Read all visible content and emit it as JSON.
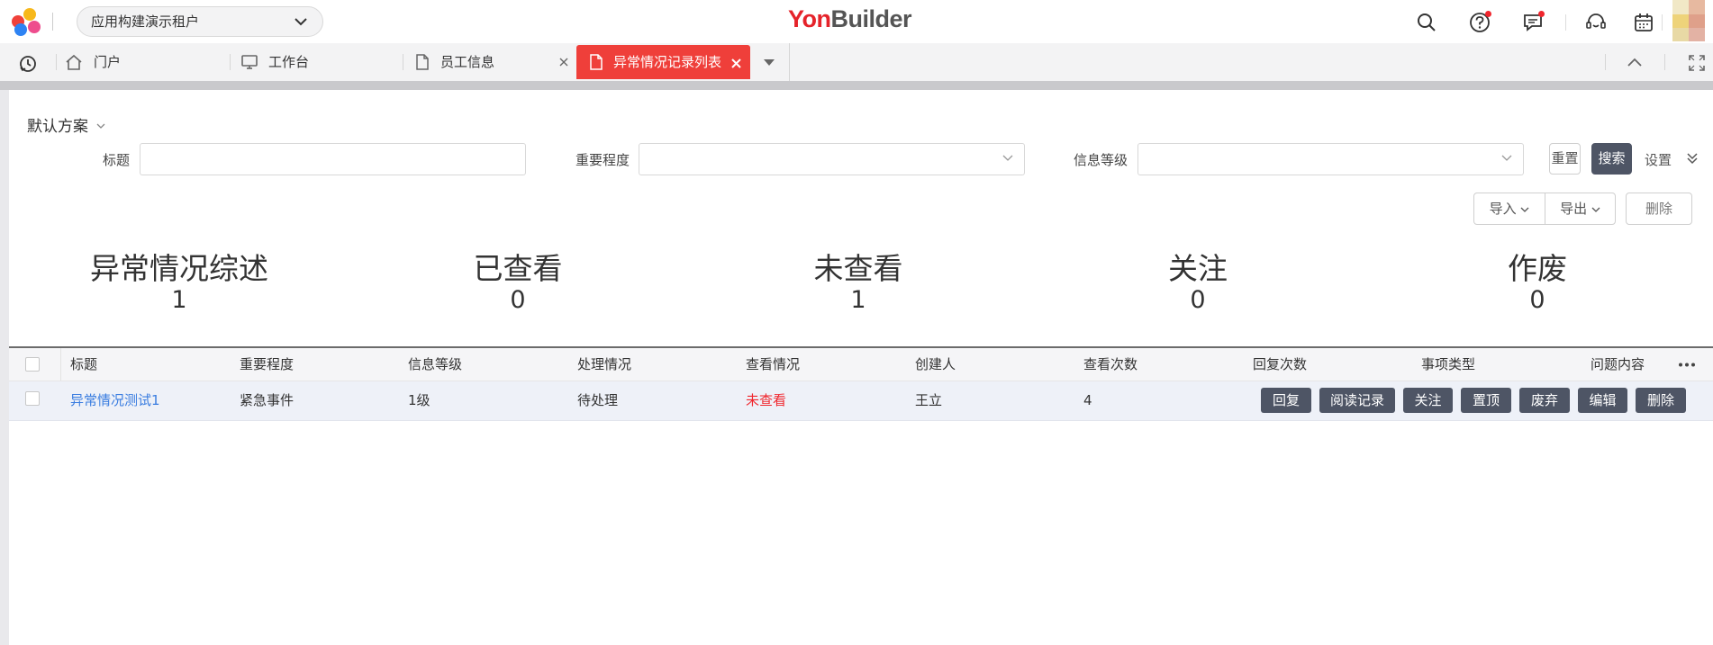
{
  "header": {
    "tenant": "应用构建演示租户",
    "brand_prefix": "Yon",
    "brand_suffix": "Builder"
  },
  "tabs": [
    {
      "label": "门户",
      "icon": "home-icon"
    },
    {
      "label": "工作台",
      "icon": "monitor-icon"
    },
    {
      "label": "员工信息",
      "icon": "document-icon"
    },
    {
      "label": "异常情况记录列表",
      "icon": "document-icon",
      "active": true
    }
  ],
  "filter": {
    "plan": "默认方案",
    "fields": [
      {
        "label": "标题",
        "type": "text",
        "value": ""
      },
      {
        "label": "重要程度",
        "type": "select",
        "value": ""
      },
      {
        "label": "信息等级",
        "type": "select",
        "value": ""
      }
    ],
    "reset": "重置",
    "search": "搜索",
    "settings": "设置"
  },
  "toolbar": {
    "import": "导入",
    "export": "导出",
    "delete": "删除"
  },
  "stats": [
    {
      "title": "异常情况综述",
      "value": "1"
    },
    {
      "title": "已查看",
      "value": "0"
    },
    {
      "title": "未查看",
      "value": "1"
    },
    {
      "title": "关注",
      "value": "0"
    },
    {
      "title": "作废",
      "value": "0"
    }
  ],
  "table": {
    "columns": [
      "标题",
      "重要程度",
      "信息等级",
      "处理情况",
      "查看情况",
      "创建人",
      "查看次数",
      "回复次数",
      "事项类型",
      "问题内容"
    ],
    "rows": [
      {
        "title": "异常情况测试1",
        "importance": "紧急事件",
        "level": "1级",
        "status": "待处理",
        "view_status": "未查看",
        "creator": "王立",
        "view_count": "4"
      }
    ],
    "row_actions": [
      "回复",
      "阅读记录",
      "关注",
      "置顶",
      "废弃",
      "编辑",
      "删除"
    ]
  },
  "colors": {
    "accent_red": "#ef3f3a",
    "dark_button": "#4e5565",
    "link_blue": "#3a7de0",
    "unread_red": "#f0262d"
  }
}
